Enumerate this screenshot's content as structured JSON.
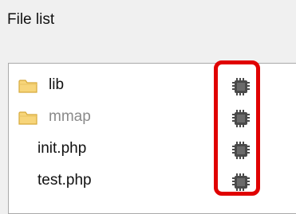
{
  "header": {
    "title": "File list"
  },
  "file_list": {
    "items": [
      {
        "label": "lib",
        "kind": "folder",
        "icon": "folder-icon",
        "action_icon": "chip-icon",
        "muted": false
      },
      {
        "label": "mmap",
        "kind": "folder",
        "icon": "folder-icon",
        "action_icon": "chip-icon",
        "muted": true
      },
      {
        "label": "init.php",
        "kind": "file",
        "action_icon": "chip-icon",
        "muted": false
      },
      {
        "label": "test.php",
        "kind": "file",
        "action_icon": "chip-icon",
        "muted": false
      }
    ]
  },
  "colors": {
    "background": "#f0f0f0",
    "panel": "#ffffff",
    "folder_fill": "#f7d57a",
    "folder_stroke": "#d6a93a",
    "highlight": "#e00000",
    "chip": "#4a4a4a"
  }
}
